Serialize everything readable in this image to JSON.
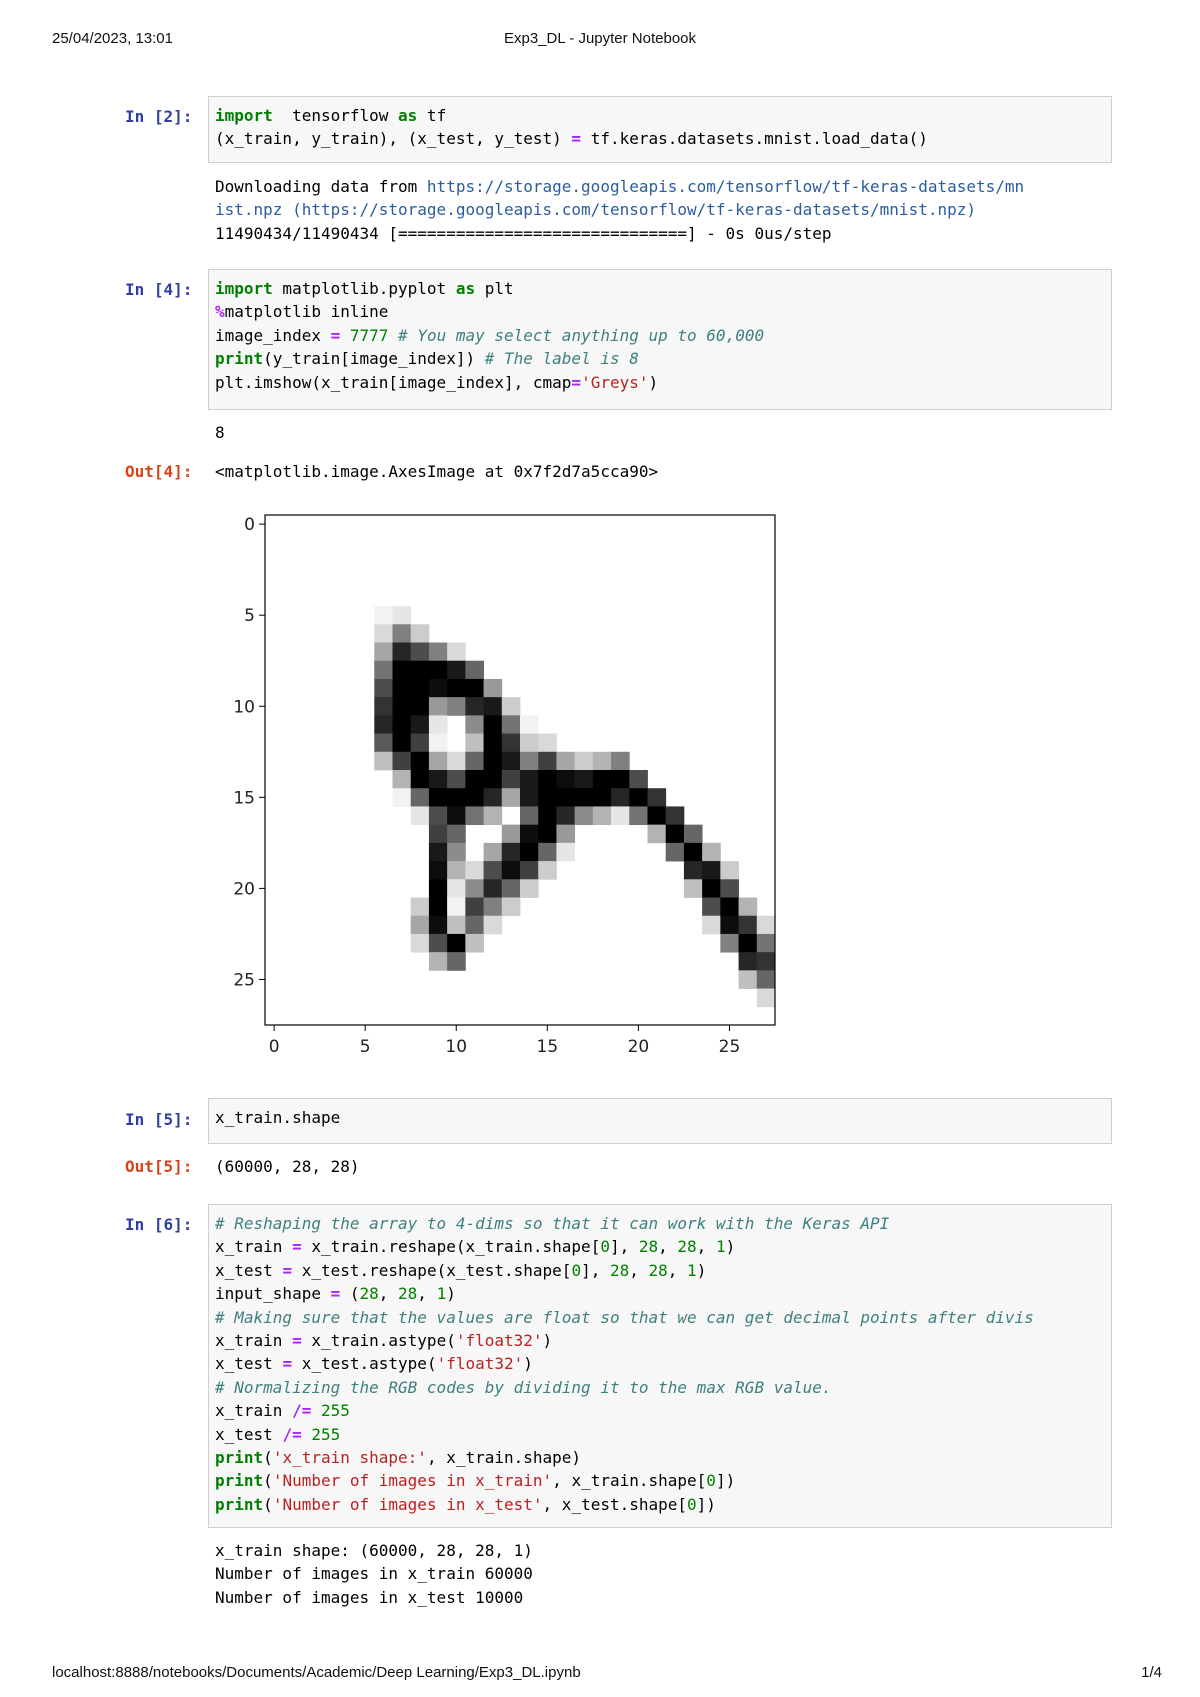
{
  "header": {
    "datetime": "25/04/2023, 13:01",
    "title": "Exp3_DL - Jupyter Notebook"
  },
  "footer": {
    "url": "localhost:8888/notebooks/Documents/Academic/Deep Learning/Exp3_DL.ipynb",
    "page": "1/4"
  },
  "cells": [
    {
      "prompt": "In [2]:",
      "code_lines": [
        [
          [
            "kw",
            "import"
          ],
          [
            "",
            "  tensorflow "
          ],
          [
            "kw",
            "as"
          ],
          [
            "",
            " tf"
          ]
        ],
        [
          [
            "",
            "(x_train, y_train), (x_test, y_test) "
          ],
          [
            "op",
            "="
          ],
          [
            "",
            " tf.keras.datasets.mnist.load_data()"
          ]
        ]
      ],
      "output_lines": [
        [
          [
            "",
            "Downloading data from "
          ],
          [
            "url",
            "https://storage.googleapis.com/tensorflow/tf-keras-datasets/mn"
          ]
        ],
        [
          [
            "url",
            "ist.npz (https://storage.googleapis.com/tensorflow/tf-keras-datasets/mnist.npz)"
          ]
        ],
        [
          [
            "",
            "11490434/11490434 [==============================] - 0s 0us/step"
          ]
        ]
      ]
    },
    {
      "prompt": "In [4]:",
      "code_lines": [
        [
          [
            "kw",
            "import"
          ],
          [
            "",
            " matplotlib.pyplot "
          ],
          [
            "kw",
            "as"
          ],
          [
            "",
            " plt"
          ]
        ],
        [
          [
            "mg",
            "%"
          ],
          [
            "",
            "matplotlib inline"
          ]
        ],
        [
          [
            "",
            "image_index "
          ],
          [
            "op",
            "="
          ],
          [
            "",
            " "
          ],
          [
            "num",
            "7777"
          ],
          [
            "",
            " "
          ],
          [
            "cm",
            "# You may select anything up to 60,000"
          ]
        ],
        [
          [
            "kw",
            "print"
          ],
          [
            "",
            "(y_train[image_index]) "
          ],
          [
            "cm",
            "# The label is 8"
          ]
        ],
        [
          [
            "",
            "plt.imshow(x_train[image_index], cmap"
          ],
          [
            "op",
            "="
          ],
          [
            "str",
            "'Greys'"
          ],
          [
            "",
            ")"
          ]
        ]
      ],
      "stdout": "8",
      "out_prompt": "Out[4]:",
      "out_text": "<matplotlib.image.AxesImage at 0x7f2d7a5cca90>"
    },
    {
      "prompt": "In [5]:",
      "code_lines": [
        [
          [
            "",
            "x_train.shape"
          ]
        ]
      ],
      "out_prompt": "Out[5]:",
      "out_text": "(60000, 28, 28)"
    },
    {
      "prompt": "In [6]:",
      "code_lines": [
        [
          [
            "cm",
            "# Reshaping the array to 4-dims so that it can work with the Keras API"
          ]
        ],
        [
          [
            "",
            "x_train "
          ],
          [
            "op",
            "="
          ],
          [
            "",
            " x_train.reshape(x_train.shape["
          ],
          [
            "num",
            "0"
          ],
          [
            "",
            "], "
          ],
          [
            "num",
            "28"
          ],
          [
            "",
            ", "
          ],
          [
            "num",
            "28"
          ],
          [
            "",
            ", "
          ],
          [
            "num",
            "1"
          ],
          [
            "",
            ")"
          ]
        ],
        [
          [
            "",
            "x_test "
          ],
          [
            "op",
            "="
          ],
          [
            "",
            " x_test.reshape(x_test.shape["
          ],
          [
            "num",
            "0"
          ],
          [
            "",
            "], "
          ],
          [
            "num",
            "28"
          ],
          [
            "",
            ", "
          ],
          [
            "num",
            "28"
          ],
          [
            "",
            ", "
          ],
          [
            "num",
            "1"
          ],
          [
            "",
            ")"
          ]
        ],
        [
          [
            "",
            "input_shape "
          ],
          [
            "op",
            "="
          ],
          [
            "",
            " ("
          ],
          [
            "num",
            "28"
          ],
          [
            "",
            ", "
          ],
          [
            "num",
            "28"
          ],
          [
            "",
            ", "
          ],
          [
            "num",
            "1"
          ],
          [
            "",
            ")"
          ]
        ],
        [
          [
            "cm",
            "# Making sure that the values are float so that we can get decimal points after divis"
          ]
        ],
        [
          [
            "",
            "x_train "
          ],
          [
            "op",
            "="
          ],
          [
            "",
            " x_train.astype("
          ],
          [
            "str",
            "'float32'"
          ],
          [
            "",
            ")"
          ]
        ],
        [
          [
            "",
            "x_test "
          ],
          [
            "op",
            "="
          ],
          [
            "",
            " x_test.astype("
          ],
          [
            "str",
            "'float32'"
          ],
          [
            "",
            ")"
          ]
        ],
        [
          [
            "cm",
            "# Normalizing the RGB codes by dividing it to the max RGB value."
          ]
        ],
        [
          [
            "",
            "x_train "
          ],
          [
            "op",
            "/="
          ],
          [
            "",
            " "
          ],
          [
            "num",
            "255"
          ]
        ],
        [
          [
            "",
            "x_test "
          ],
          [
            "op",
            "/="
          ],
          [
            "",
            " "
          ],
          [
            "num",
            "255"
          ]
        ],
        [
          [
            "kw",
            "print"
          ],
          [
            "",
            "("
          ],
          [
            "str",
            "'x_train shape:'"
          ],
          [
            "",
            ", x_train.shape)"
          ]
        ],
        [
          [
            "kw",
            "print"
          ],
          [
            "",
            "("
          ],
          [
            "str",
            "'Number of images in x_train'"
          ],
          [
            "",
            ", x_train.shape["
          ],
          [
            "num",
            "0"
          ],
          [
            "",
            "])"
          ]
        ],
        [
          [
            "kw",
            "print"
          ],
          [
            "",
            "("
          ],
          [
            "str",
            "'Number of images in x_test'"
          ],
          [
            "",
            ", x_test.shape["
          ],
          [
            "num",
            "0"
          ],
          [
            "",
            "])"
          ]
        ]
      ],
      "output_lines": [
        [
          [
            "",
            "x_train shape: (60000, 28, 28, 1)"
          ]
        ],
        [
          [
            "",
            "Number of images in x_train 60000"
          ]
        ],
        [
          [
            "",
            "Number of images in x_test 10000"
          ]
        ]
      ]
    }
  ],
  "plot": {
    "yticks": [
      "0",
      "5",
      "10",
      "15",
      "20",
      "25"
    ],
    "xticks": [
      "0",
      "5",
      "10",
      "15",
      "20",
      "25"
    ],
    "cmap": "Greys",
    "pixels": [
      [
        5,
        20,
        0.05
      ],
      [
        6,
        20,
        0.15
      ],
      [
        7,
        20,
        0.35
      ],
      [
        8,
        20,
        0.55
      ],
      [
        9,
        20,
        0.7
      ],
      [
        10,
        20,
        0.8
      ],
      [
        11,
        20,
        0.85
      ],
      [
        12,
        20,
        0.65
      ],
      [
        13,
        20,
        0.25
      ],
      [
        5,
        21,
        0.1
      ],
      [
        6,
        21,
        0.5
      ],
      [
        7,
        21,
        0.85
      ],
      [
        8,
        21,
        1
      ],
      [
        9,
        21,
        1
      ],
      [
        10,
        21,
        1
      ],
      [
        11,
        21,
        1
      ],
      [
        12,
        21,
        1
      ],
      [
        13,
        21,
        0.75
      ],
      [
        14,
        21,
        0.3
      ],
      [
        15,
        21,
        0.05
      ],
      [
        6,
        22,
        0.2
      ],
      [
        7,
        22,
        0.7
      ],
      [
        8,
        22,
        1
      ],
      [
        9,
        22,
        1
      ],
      [
        10,
        22,
        1
      ],
      [
        11,
        22,
        0.9
      ],
      [
        12,
        22,
        0.75
      ],
      [
        13,
        22,
        1
      ],
      [
        14,
        22,
        1
      ],
      [
        15,
        22,
        0.6
      ],
      [
        16,
        22,
        0.1
      ],
      [
        21,
        22,
        0.2
      ],
      [
        22,
        22,
        0.35
      ],
      [
        23,
        22,
        0.15
      ],
      [
        7,
        23,
        0.5
      ],
      [
        8,
        23,
        1
      ],
      [
        9,
        23,
        0.95
      ],
      [
        10,
        23,
        0.4
      ],
      [
        11,
        23,
        0.1
      ],
      [
        12,
        23,
        0.05
      ],
      [
        13,
        23,
        0.35
      ],
      [
        14,
        23,
        0.9
      ],
      [
        15,
        23,
        1
      ],
      [
        16,
        23,
        0.7
      ],
      [
        17,
        23,
        0.75
      ],
      [
        18,
        23,
        0.9
      ],
      [
        19,
        23,
        0.95
      ],
      [
        20,
        23,
        1
      ],
      [
        21,
        23,
        1
      ],
      [
        22,
        23,
        0.95
      ],
      [
        23,
        23,
        0.7
      ],
      [
        24,
        23,
        0.3
      ],
      [
        7,
        24,
        0.15
      ],
      [
        8,
        24,
        0.9
      ],
      [
        9,
        24,
        1
      ],
      [
        10,
        24,
        0.5
      ],
      [
        13,
        24,
        0.15
      ],
      [
        14,
        24,
        0.7
      ],
      [
        15,
        24,
        1
      ],
      [
        16,
        24,
        0.95
      ],
      [
        17,
        24,
        0.6
      ],
      [
        18,
        24,
        0.45
      ],
      [
        19,
        24,
        0.3
      ],
      [
        20,
        24,
        0.1
      ],
      [
        21,
        24,
        0.05
      ],
      [
        22,
        24,
        0.25
      ],
      [
        23,
        24,
        1
      ],
      [
        24,
        24,
        0.6
      ],
      [
        8,
        25,
        0.6
      ],
      [
        9,
        25,
        1
      ],
      [
        10,
        25,
        0.85
      ],
      [
        11,
        25,
        0.45
      ],
      [
        12,
        25,
        0.25
      ],
      [
        13,
        25,
        0.6
      ],
      [
        14,
        25,
        1
      ],
      [
        15,
        25,
        1
      ],
      [
        16,
        25,
        0.55
      ],
      [
        19,
        25,
        0.15
      ],
      [
        20,
        25,
        0.45
      ],
      [
        21,
        25,
        0.75
      ],
      [
        22,
        25,
        0.6
      ],
      [
        23,
        25,
        0.25
      ],
      [
        9,
        26,
        0.4
      ],
      [
        10,
        26,
        0.9
      ],
      [
        11,
        26,
        1
      ],
      [
        12,
        26,
        1
      ],
      [
        13,
        26,
        1
      ],
      [
        14,
        26,
        1
      ],
      [
        15,
        26,
        0.85
      ],
      [
        16,
        26,
        0.3
      ],
      [
        18,
        26,
        0.35
      ],
      [
        19,
        26,
        0.7
      ],
      [
        20,
        26,
        0.85
      ],
      [
        21,
        26,
        0.5
      ],
      [
        22,
        26,
        0.15
      ],
      [
        10,
        27,
        0.2
      ],
      [
        11,
        27,
        0.55
      ],
      [
        12,
        27,
        0.8
      ],
      [
        13,
        27,
        0.9
      ],
      [
        14,
        27,
        0.75
      ],
      [
        15,
        27,
        0.35
      ],
      [
        17,
        27,
        0.4
      ],
      [
        18,
        27,
        0.85
      ],
      [
        19,
        27,
        0.95
      ],
      [
        20,
        27,
        0.6
      ],
      [
        21,
        27,
        0.2
      ],
      [
        11,
        28,
        0.05
      ],
      [
        12,
        28,
        0.2
      ],
      [
        13,
        28,
        0.5
      ],
      [
        14,
        28,
        0.9
      ],
      [
        15,
        28,
        0.9
      ],
      [
        16,
        28,
        0.6
      ],
      [
        17,
        28,
        0.95
      ],
      [
        18,
        28,
        1
      ],
      [
        19,
        28,
        0.75
      ],
      [
        20,
        28,
        0.2
      ],
      [
        12,
        29,
        0.15
      ],
      [
        13,
        29,
        0.75
      ],
      [
        14,
        29,
        1
      ],
      [
        15,
        29,
        1
      ],
      [
        16,
        29,
        1
      ],
      [
        17,
        29,
        1
      ],
      [
        18,
        29,
        0.6
      ],
      [
        19,
        29,
        0.2
      ],
      [
        13,
        30,
        0.35
      ],
      [
        14,
        30,
        0.95
      ],
      [
        15,
        30,
        1
      ],
      [
        16,
        30,
        0.85
      ],
      [
        17,
        30,
        0.4
      ],
      [
        18,
        30,
        0.1
      ],
      [
        13,
        31,
        0.2
      ],
      [
        14,
        31,
        0.9
      ],
      [
        15,
        31,
        1
      ],
      [
        16,
        31,
        0.45
      ],
      [
        13,
        32,
        0.3
      ],
      [
        14,
        32,
        1
      ],
      [
        15,
        32,
        1
      ],
      [
        16,
        32,
        0.3
      ],
      [
        13,
        33,
        0.5
      ],
      [
        14,
        33,
        1
      ],
      [
        15,
        33,
        0.85
      ],
      [
        16,
        33,
        0.1
      ],
      [
        14,
        34,
        0.7
      ],
      [
        15,
        34,
        1
      ],
      [
        16,
        34,
        0.55
      ],
      [
        15,
        35,
        0.8
      ],
      [
        16,
        35,
        1
      ],
      [
        17,
        35,
        0.3
      ],
      [
        16,
        36,
        0.8
      ],
      [
        17,
        36,
        1
      ],
      [
        18,
        36,
        0.6
      ],
      [
        17,
        37,
        0.6
      ],
      [
        18,
        37,
        1
      ],
      [
        19,
        37,
        0.85
      ],
      [
        20,
        37,
        0.25
      ],
      [
        18,
        38,
        0.3
      ],
      [
        19,
        38,
        0.9
      ],
      [
        20,
        38,
        1
      ],
      [
        21,
        38,
        0.7
      ],
      [
        22,
        38,
        0.15
      ],
      [
        19,
        39,
        0.2
      ],
      [
        20,
        39,
        0.7
      ],
      [
        21,
        39,
        1
      ],
      [
        22,
        39,
        0.95
      ],
      [
        23,
        39,
        0.5
      ],
      [
        21,
        40,
        0.3
      ],
      [
        22,
        40,
        0.8
      ],
      [
        23,
        40,
        1
      ],
      [
        24,
        40,
        0.85
      ],
      [
        25,
        40,
        0.25
      ],
      [
        22,
        41,
        0.15
      ],
      [
        23,
        41,
        0.55
      ],
      [
        24,
        41,
        0.8
      ],
      [
        25,
        41,
        0.6
      ],
      [
        26,
        41,
        0.15
      ]
    ]
  }
}
